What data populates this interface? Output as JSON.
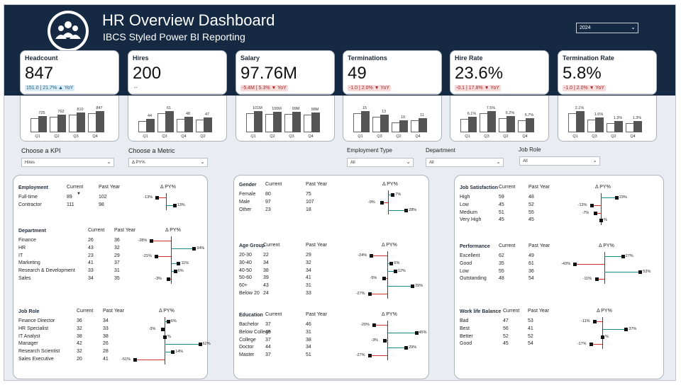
{
  "header": {
    "title": "HR Overview Dashboard",
    "subtitle": "IBCS Styled Power BI Reporting",
    "year": "2024"
  },
  "kpis": [
    {
      "title": "Headcount",
      "value": "847",
      "delta": "151.0 | 21.7% ▲ YoY",
      "tone": "pos",
      "bars": [
        {
          "cat": "Q1",
          "v": 725,
          "label": "725"
        },
        {
          "cat": "Q2",
          "v": 762,
          "label": "762"
        },
        {
          "cat": "Q3",
          "v": 810,
          "label": "810"
        },
        {
          "cat": "Q4",
          "v": 847,
          "label": "847"
        }
      ]
    },
    {
      "title": "Hires",
      "value": "200",
      "delta": "--",
      "tone": "neu",
      "bars": [
        {
          "cat": "Q1",
          "v": 44,
          "label": "44"
        },
        {
          "cat": "Q3",
          "v": 61,
          "label": "61"
        },
        {
          "cat": "Q4",
          "v": 48,
          "label": "48"
        },
        {
          "cat": "Q2",
          "v": 47,
          "label": "47"
        }
      ]
    },
    {
      "title": "Salary",
      "value": "97.76M",
      "delta": "-5.4M | 5.3% ▼ YoY",
      "tone": "neg",
      "bars": [
        {
          "cat": "Q1",
          "v": 101,
          "label": "101M"
        },
        {
          "cat": "Q2",
          "v": 100,
          "label": "100M"
        },
        {
          "cat": "Q3",
          "v": 99,
          "label": "99M"
        },
        {
          "cat": "Q4",
          "v": 98,
          "label": "98M"
        }
      ]
    },
    {
      "title": "Terminations",
      "value": "49",
      "delta": "-1.0 | 2.0% ▼ YoY",
      "tone": "neg",
      "bars": [
        {
          "cat": "Q1",
          "v": 15,
          "label": "15"
        },
        {
          "cat": "Q3",
          "v": 13,
          "label": "13"
        },
        {
          "cat": "Q2",
          "v": 10,
          "label": "10"
        },
        {
          "cat": "Q4",
          "v": 11,
          "label": "11"
        }
      ]
    },
    {
      "title": "Hire Rate",
      "value": "23.6%",
      "delta": "-0.1 | 17.8% ▼ YoY",
      "tone": "neg",
      "bars": [
        {
          "cat": "Q1",
          "v": 6.1,
          "label": "6.1%"
        },
        {
          "cat": "Q3",
          "v": 7.5,
          "label": "7.5%"
        },
        {
          "cat": "Q2",
          "v": 6.2,
          "label": "6.2%"
        },
        {
          "cat": "Q4",
          "v": 5.7,
          "label": "5.7%"
        }
      ]
    },
    {
      "title": "Termination Rate",
      "value": "5.8%",
      "delta": "-1.0 | 2.0% ▼ YoY",
      "tone": "neg",
      "bars": [
        {
          "cat": "Q1",
          "v": 2.1,
          "label": "2.1%"
        },
        {
          "cat": "Q3",
          "v": 1.6,
          "label": "1.6%"
        },
        {
          "cat": "Q2",
          "v": 1.3,
          "label": "1.3%"
        },
        {
          "cat": "Q4",
          "v": 1.3,
          "label": "1.3%"
        }
      ]
    }
  ],
  "slicers": {
    "kpi": {
      "label": "Choose a KPI",
      "value": "Hires"
    },
    "metric": {
      "label": "Choose a Metric",
      "value": "Δ PY%"
    },
    "employment": {
      "label": "Employment Type",
      "value": "All"
    },
    "department": {
      "label": "Department",
      "value": "All"
    },
    "jobrole": {
      "label": "Job Role",
      "value": "All"
    }
  },
  "headers": {
    "current": "Current",
    "past": "Past Year",
    "delta": "Δ PY%"
  },
  "tables": [
    {
      "name": "Employment",
      "rows": [
        {
          "c": "Full-time",
          "cur": "89",
          "py": "102",
          "d": -13,
          "dl": "-13%"
        },
        {
          "c": "Contractor",
          "cur": "111",
          "py": "98",
          "d": 13,
          "dl": "13%"
        }
      ]
    },
    {
      "name": "Department",
      "rows": [
        {
          "c": "Finance",
          "cur": "26",
          "py": "36",
          "d": -28,
          "dl": "-28%"
        },
        {
          "c": "HR",
          "cur": "43",
          "py": "32",
          "d": 34,
          "dl": "34%"
        },
        {
          "c": "IT",
          "cur": "23",
          "py": "29",
          "d": -21,
          "dl": "-21%"
        },
        {
          "c": "Marketing",
          "cur": "41",
          "py": "37",
          "d": 11,
          "dl": "11%"
        },
        {
          "c": "Research & Development",
          "cur": "33",
          "py": "31",
          "d": 6,
          "dl": "6%"
        },
        {
          "c": "Sales",
          "cur": "34",
          "py": "35",
          "d": -3,
          "dl": "-3%"
        }
      ]
    },
    {
      "name": "Job Role",
      "rows": [
        {
          "c": "Finance Director",
          "cur": "36",
          "py": "34",
          "d": 6,
          "dl": "6%"
        },
        {
          "c": "HR Specialist",
          "cur": "32",
          "py": "33",
          "d": -3,
          "dl": "-3%"
        },
        {
          "c": "IT Analyst",
          "cur": "38",
          "py": "38",
          "d": 0,
          "dl": "%"
        },
        {
          "c": "Manager",
          "cur": "42",
          "py": "26",
          "d": 62,
          "dl": "62%"
        },
        {
          "c": "Research Scientist",
          "cur": "32",
          "py": "28",
          "d": 14,
          "dl": "14%"
        },
        {
          "c": "Sales Executive",
          "cur": "20",
          "py": "41",
          "d": -51,
          "dl": "-51%"
        }
      ]
    },
    {
      "name": "Gender",
      "rows": [
        {
          "c": "Female",
          "cur": "80",
          "py": "75",
          "d": 7,
          "dl": "7%"
        },
        {
          "c": "Male",
          "cur": "97",
          "py": "107",
          "d": -9,
          "dl": "-9%"
        },
        {
          "c": "Other",
          "cur": "23",
          "py": "18",
          "d": 28,
          "dl": "28%"
        }
      ]
    },
    {
      "name": "Age Group",
      "rows": [
        {
          "c": "20-30",
          "cur": "22",
          "py": "29",
          "d": -24,
          "dl": "-24%"
        },
        {
          "c": "30-40",
          "cur": "34",
          "py": "32",
          "d": 6,
          "dl": "6%"
        },
        {
          "c": "40-50",
          "cur": "38",
          "py": "34",
          "d": 12,
          "dl": "12%"
        },
        {
          "c": "50-60",
          "cur": "39",
          "py": "41",
          "d": -5,
          "dl": "-5%"
        },
        {
          "c": "60+",
          "cur": "43",
          "py": "31",
          "d": 39,
          "dl": "39%"
        },
        {
          "c": "Below 20",
          "cur": "24",
          "py": "33",
          "d": -27,
          "dl": "-27%"
        }
      ]
    },
    {
      "name": "Education",
      "rows": [
        {
          "c": "Bachelor",
          "cur": "37",
          "py": "46",
          "d": -20,
          "dl": "-20%"
        },
        {
          "c": "Below College",
          "cur": "45",
          "py": "31",
          "d": 45,
          "dl": "45%"
        },
        {
          "c": "College",
          "cur": "37",
          "py": "38",
          "d": -3,
          "dl": "-3%"
        },
        {
          "c": "Doctor",
          "cur": "44",
          "py": "34",
          "d": 29,
          "dl": "29%"
        },
        {
          "c": "Master",
          "cur": "37",
          "py": "51",
          "d": -27,
          "dl": "-27%"
        }
      ]
    },
    {
      "name": "Job Satisfaction",
      "rows": [
        {
          "c": "High",
          "cur": "59",
          "py": "48",
          "d": 23,
          "dl": "23%"
        },
        {
          "c": "Low",
          "cur": "45",
          "py": "52",
          "d": -13,
          "dl": "-13%"
        },
        {
          "c": "Medium",
          "cur": "51",
          "py": "55",
          "d": -7,
          "dl": "-7%"
        },
        {
          "c": "Very High",
          "cur": "45",
          "py": "45",
          "d": 0,
          "dl": "%"
        }
      ]
    },
    {
      "name": "Performance",
      "rows": [
        {
          "c": "Excellent",
          "cur": "62",
          "py": "49",
          "d": 27,
          "dl": "27%"
        },
        {
          "c": "Good",
          "cur": "35",
          "py": "61",
          "d": -43,
          "dl": "-43%"
        },
        {
          "c": "Low",
          "cur": "55",
          "py": "36",
          "d": 53,
          "dl": "53%"
        },
        {
          "c": "Outstanding",
          "cur": "48",
          "py": "54",
          "d": -11,
          "dl": "-11%"
        }
      ]
    },
    {
      "name": "Work life Balance",
      "rows": [
        {
          "c": "Bad",
          "cur": "47",
          "py": "53",
          "d": -11,
          "dl": "-11%"
        },
        {
          "c": "Best",
          "cur": "56",
          "py": "41",
          "d": 37,
          "dl": "37%"
        },
        {
          "c": "Better",
          "cur": "52",
          "py": "52",
          "d": 0,
          "dl": "%"
        },
        {
          "c": "Good",
          "cur": "45",
          "py": "54",
          "d": -17,
          "dl": "-17%"
        }
      ]
    }
  ]
}
